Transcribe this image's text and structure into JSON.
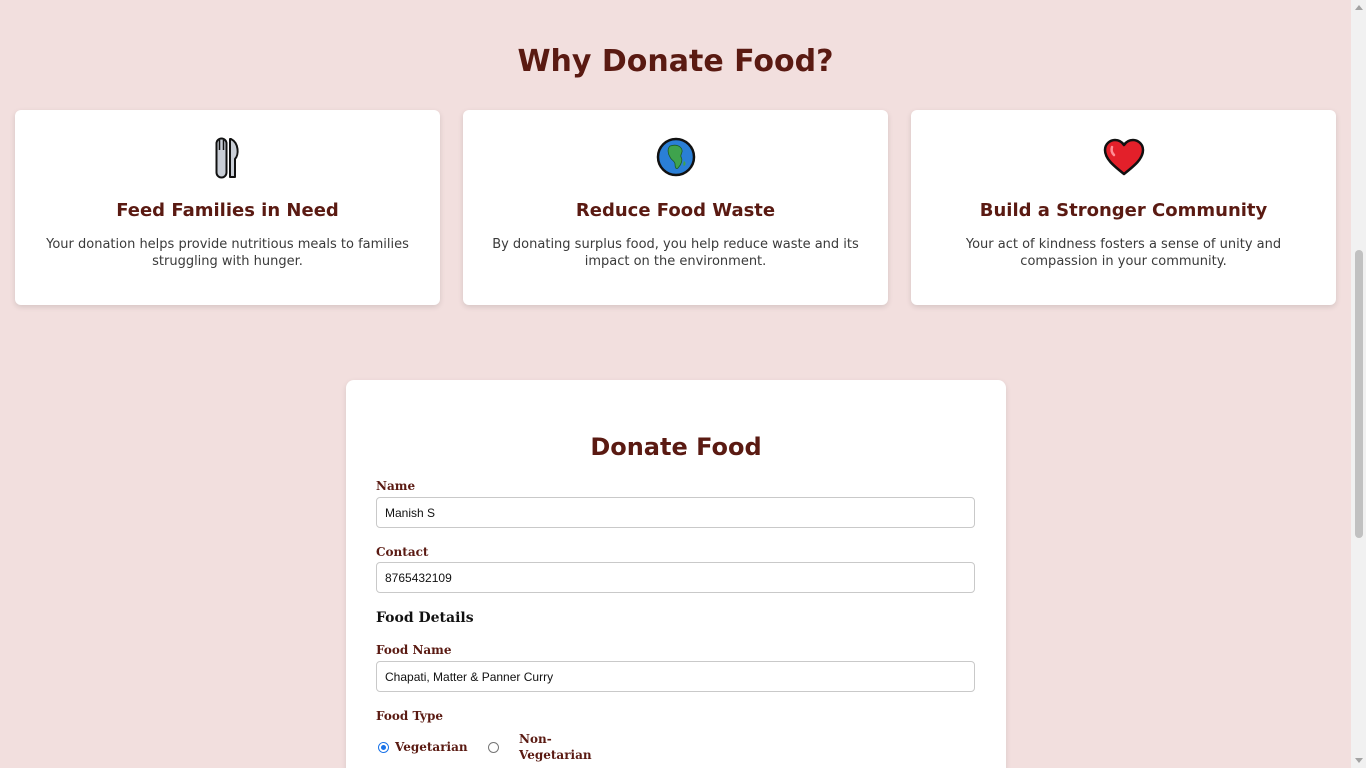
{
  "why_section": {
    "title": "Why Donate Food?",
    "cards": [
      {
        "icon": "fork-and-knife-icon",
        "title": "Feed Families in Need",
        "text": "Your donation helps provide nutritious meals to families struggling with hunger."
      },
      {
        "icon": "globe-africa-icon",
        "title": "Reduce Food Waste",
        "text": "By donating surplus food, you help reduce waste and its impact on the environment."
      },
      {
        "icon": "heart-icon",
        "title": "Build a Stronger Community",
        "text": "Your act of kindness fosters a sense of unity and compassion in your community."
      }
    ]
  },
  "form": {
    "title": "Donate Food",
    "name_label": "Name",
    "name_value": "Manish S",
    "contact_label": "Contact",
    "contact_value": "8765432109",
    "food_details_heading": "Food Details",
    "food_name_label": "Food Name",
    "food_name_value": "Chapati, Matter & Panner Curry",
    "food_type_label": "Food Type",
    "food_type_options": [
      {
        "label": "Vegetarian",
        "checked": true
      },
      {
        "label": "Non-Vegetarian",
        "checked": false
      }
    ]
  },
  "colors": {
    "background": "#f2dfde",
    "accent_text": "#5a1a12",
    "radio_selected": "#1a73e8"
  }
}
